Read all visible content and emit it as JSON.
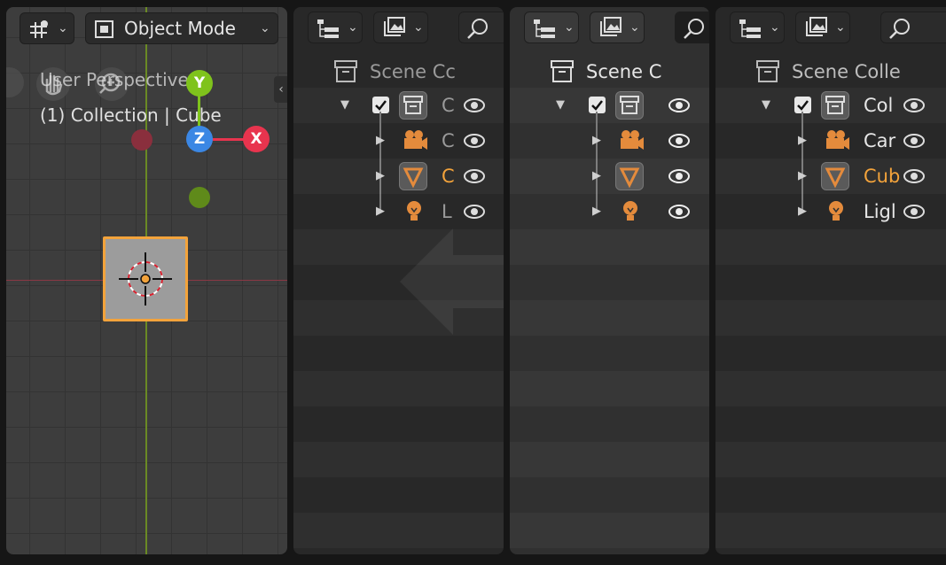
{
  "viewport": {
    "mode_label": "Object Mode",
    "overlay_line1": "User Perspective",
    "overlay_line2": "(1) Collection | Cube",
    "gizmo": {
      "y": "Y",
      "z": "Z",
      "x": "X"
    }
  },
  "outliners": [
    {
      "scene_label": "Scene Cc",
      "items": [
        {
          "label": "C",
          "icon": "collection-icon",
          "color": "#9a9a9a"
        },
        {
          "label": "C",
          "icon": "camera-icon",
          "color": "#9a9a9a"
        },
        {
          "label": "C",
          "icon": "mesh-icon",
          "color": "#f3a33b"
        },
        {
          "label": "L",
          "icon": "light-icon",
          "color": "#9a9a9a"
        }
      ]
    },
    {
      "scene_label": "Scene C",
      "items": [
        {
          "label": "",
          "icon": "collection-icon",
          "color": "#9a9a9a"
        },
        {
          "label": "",
          "icon": "camera-icon",
          "color": "#9a9a9a"
        },
        {
          "label": "",
          "icon": "mesh-icon",
          "color": "#f3a33b"
        },
        {
          "label": "",
          "icon": "light-icon",
          "color": "#9a9a9a"
        }
      ]
    },
    {
      "scene_label": "Scene Colle",
      "items": [
        {
          "label": "Col",
          "icon": "collection-icon",
          "color": "#e6e6e6"
        },
        {
          "label": "Car",
          "icon": "camera-icon",
          "color": "#e6e6e6"
        },
        {
          "label": "Cub",
          "icon": "mesh-icon",
          "color": "#f3a33b"
        },
        {
          "label": "Ligl",
          "icon": "light-icon",
          "color": "#e6e6e6"
        }
      ]
    }
  ],
  "colors": {
    "accent": "#f3a33b",
    "x_axis": "#e8344e",
    "y_axis": "#7fc31c",
    "z_axis": "#3b87e4"
  }
}
